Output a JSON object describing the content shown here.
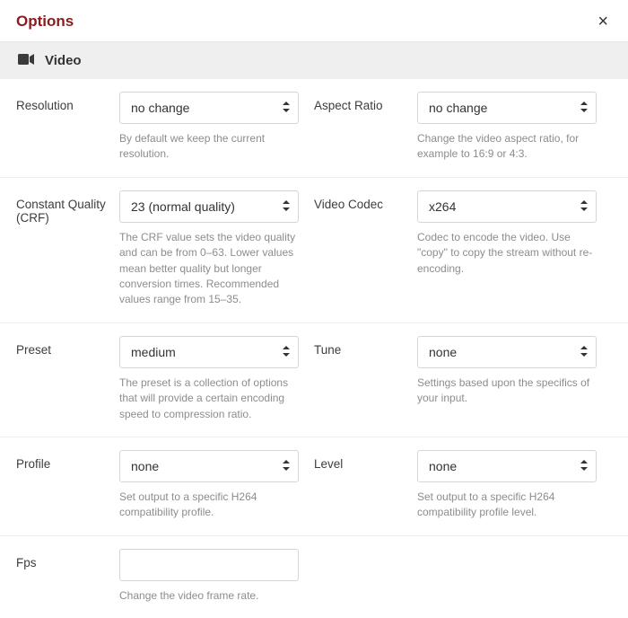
{
  "dialog": {
    "title": "Options"
  },
  "section": {
    "title": "Video"
  },
  "fields": {
    "resolution": {
      "label": "Resolution",
      "value": "no change",
      "help": "By default we keep the current resolution."
    },
    "aspect_ratio": {
      "label": "Aspect Ratio",
      "value": "no change",
      "help": "Change the video aspect ratio, for example to 16:9 or 4:3."
    },
    "crf": {
      "label": "Constant Quality (CRF)",
      "value": "23 (normal quality)",
      "help": "The CRF value sets the video quality and can be from 0–63. Lower values mean better quality but longer conversion times. Recommended values range from 15–35."
    },
    "video_codec": {
      "label": "Video Codec",
      "value": "x264",
      "help": "Codec to encode the video. Use \"copy\" to copy the stream without re-encoding."
    },
    "preset": {
      "label": "Preset",
      "value": "medium",
      "help": "The preset is a collection of options that will provide a certain encoding speed to compression ratio."
    },
    "tune": {
      "label": "Tune",
      "value": "none",
      "help": "Settings based upon the specifics of your input."
    },
    "profile": {
      "label": "Profile",
      "value": "none",
      "help": "Set output to a specific H264 compatibility profile."
    },
    "level": {
      "label": "Level",
      "value": "none",
      "help": "Set output to a specific H264 compatibility profile level."
    },
    "fps": {
      "label": "Fps",
      "value": "",
      "help": "Change the video frame rate."
    }
  }
}
